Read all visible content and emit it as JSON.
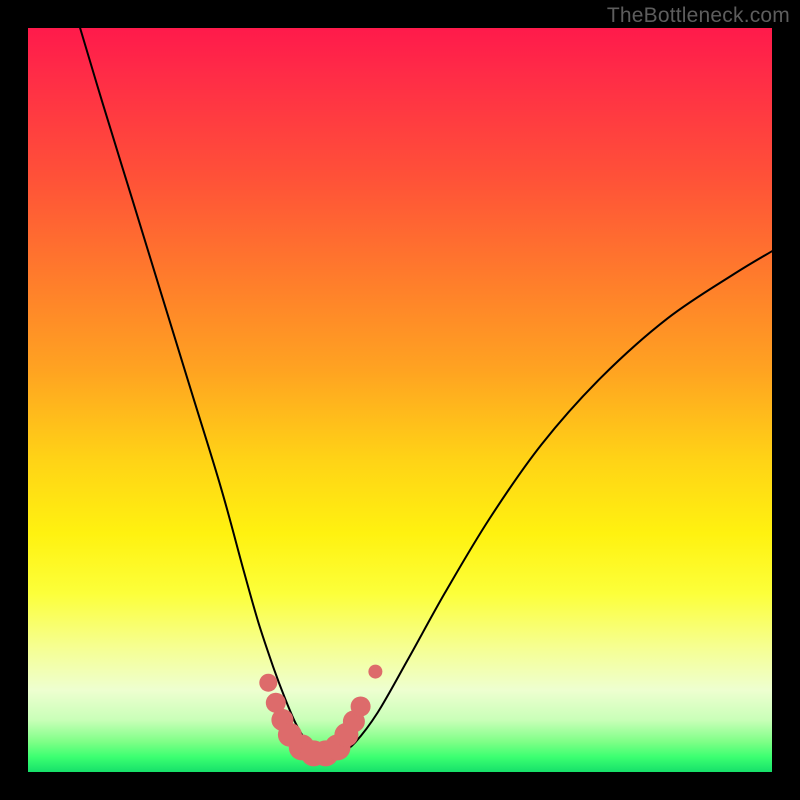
{
  "watermark": "TheBottleneck.com",
  "chart_data": {
    "type": "line",
    "title": "",
    "xlabel": "",
    "ylabel": "",
    "xlim": [
      0,
      100
    ],
    "ylim": [
      0,
      100
    ],
    "series": [
      {
        "name": "curve",
        "x": [
          7,
          10,
          14,
          18,
          22,
          26,
          29,
          31,
          33,
          34.5,
          36,
          37.5,
          39,
          40.5,
          42,
          44,
          47,
          51,
          56,
          62,
          69,
          77,
          86,
          95,
          100
        ],
        "y": [
          100,
          90,
          77,
          64,
          51,
          38,
          27,
          20,
          14,
          10,
          6.5,
          4,
          2.5,
          2,
          2.5,
          4,
          8,
          15,
          24,
          34,
          44,
          53,
          61,
          67,
          70
        ],
        "color": "#000000",
        "linewidth": 2
      }
    ],
    "markers": {
      "name": "bottom-highlight",
      "color": "#dd6b6b",
      "points_x": [
        32.3,
        33.3,
        34.2,
        35.2,
        36.8,
        38.4,
        40.0,
        41.6,
        42.8,
        43.8,
        44.7,
        46.7
      ],
      "points_y": [
        12.0,
        9.3,
        7.0,
        5.0,
        3.3,
        2.5,
        2.5,
        3.3,
        5.0,
        6.8,
        8.8,
        13.5
      ],
      "sizes": [
        9,
        10,
        11,
        12,
        13,
        13,
        13,
        13,
        12,
        11,
        10,
        7
      ]
    }
  }
}
